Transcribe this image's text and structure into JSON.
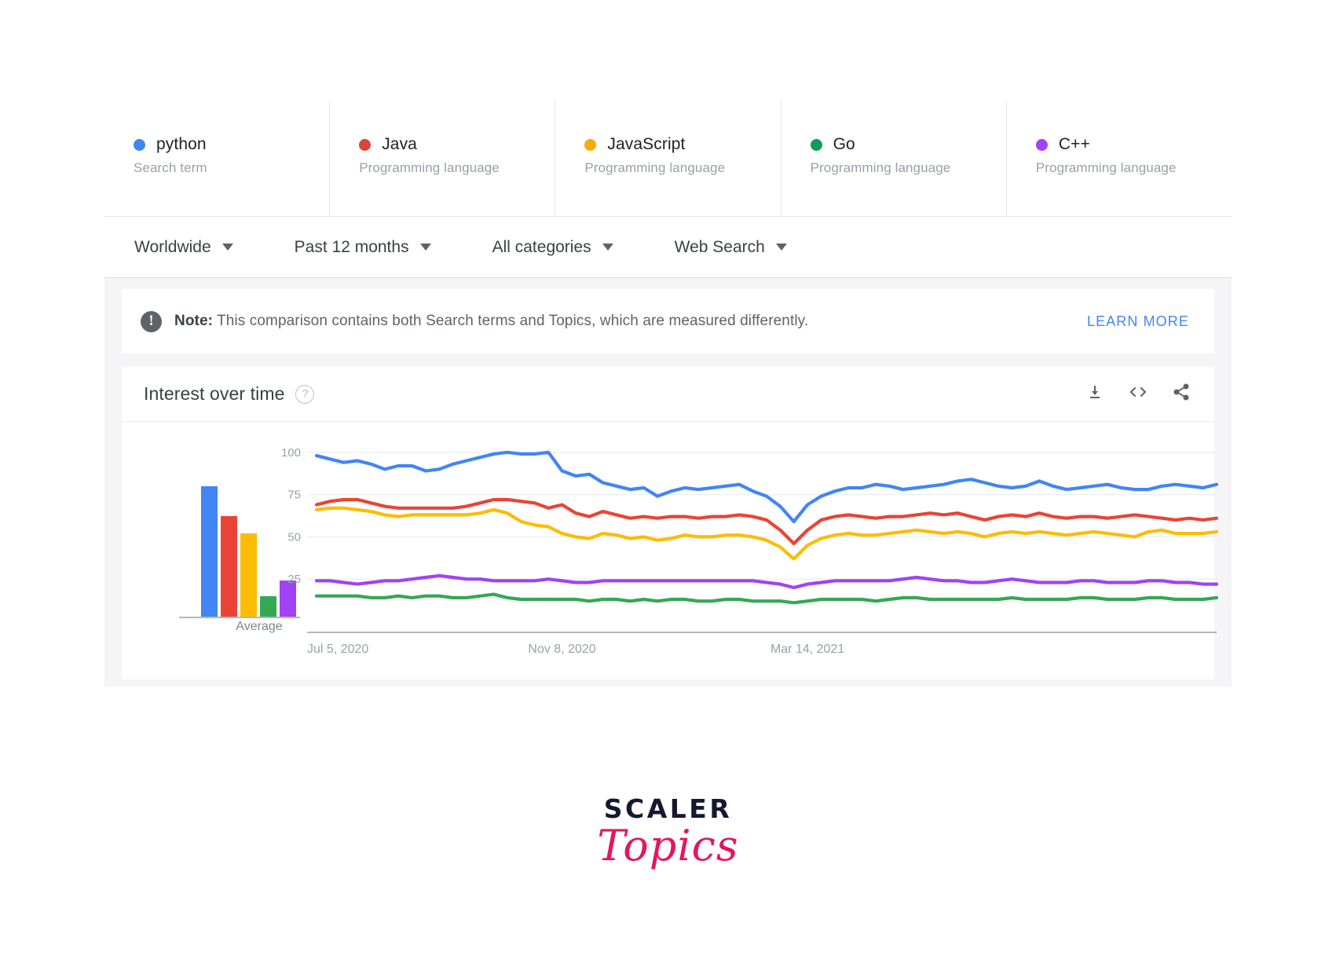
{
  "legend": {
    "items": [
      {
        "term": "python",
        "subtitle": "Search term",
        "color": "#4285f4",
        "dot": "legend-color-dot"
      },
      {
        "term": "Java",
        "subtitle": "Programming language",
        "color": "#db4437",
        "dot": "legend-color-dot"
      },
      {
        "term": "JavaScript",
        "subtitle": "Programming language",
        "color": "#f9ab00",
        "dot": "legend-color-dot"
      },
      {
        "term": "Go",
        "subtitle": "Programming language",
        "color": "#0f9d58",
        "dot": "legend-color-dot"
      },
      {
        "term": "C++",
        "subtitle": "Programming language",
        "color": "#a142f4",
        "dot": "legend-color-dot"
      }
    ]
  },
  "filters": [
    {
      "label": "Worldwide"
    },
    {
      "label": "Past 12 months"
    },
    {
      "label": "All categories"
    },
    {
      "label": "Web Search"
    }
  ],
  "note": {
    "icon": "exclamation-icon",
    "bold": "Note:",
    "text": " This comparison contains both Search terms and Topics, which are measured differently.",
    "learn_more": "LEARN MORE",
    "link_color": "#4285f4"
  },
  "chart_header": {
    "title": "Interest over time",
    "help_icon": "question-mark-icon",
    "actions": [
      {
        "name": "download-icon"
      },
      {
        "name": "embed-code-icon"
      },
      {
        "name": "share-icon"
      }
    ]
  },
  "chart_data": [
    {
      "type": "bar",
      "title": "Average",
      "categories": [
        "python",
        "Java",
        "JavaScript",
        "Go",
        "C++"
      ],
      "values": [
        83,
        64,
        53,
        13,
        23
      ],
      "colors": [
        "#4285f4",
        "#ea4335",
        "#fbbc04",
        "#34a853",
        "#a142f4"
      ],
      "ylim": [
        0,
        100
      ],
      "xlabel": "Average",
      "ylabel": "",
      "grid": false
    },
    {
      "type": "line",
      "title": "Interest over time",
      "xlabel": "",
      "ylabel": "",
      "ylim": [
        0,
        105
      ],
      "yticks": [
        25,
        50,
        75,
        100
      ],
      "grid": true,
      "legend_position": "top",
      "xtick_labels": [
        "Jul 5, 2020",
        "Nov 8, 2020",
        "Mar 14, 2021"
      ],
      "xtick_positions": [
        0,
        18,
        36
      ],
      "series": [
        {
          "name": "python",
          "color": "#4285f4",
          "values": [
            98,
            96,
            94,
            95,
            93,
            90,
            92,
            92,
            89,
            90,
            93,
            95,
            97,
            99,
            100,
            99,
            99,
            100,
            89,
            86,
            87,
            82,
            80,
            78,
            79,
            74,
            77,
            79,
            78,
            79,
            80,
            81,
            77,
            74,
            68,
            59,
            69,
            74,
            77,
            79,
            79,
            81,
            80,
            78,
            79,
            80,
            81,
            83,
            84,
            82,
            80,
            79,
            80,
            83,
            80,
            78,
            79,
            80,
            81,
            79,
            78,
            78,
            80,
            81,
            80,
            79,
            81
          ]
        },
        {
          "name": "Java",
          "color": "#ea4335",
          "values": [
            69,
            71,
            72,
            72,
            70,
            68,
            67,
            67,
            67,
            67,
            67,
            68,
            70,
            72,
            72,
            71,
            70,
            67,
            69,
            64,
            62,
            65,
            63,
            61,
            62,
            61,
            62,
            62,
            61,
            62,
            62,
            63,
            62,
            60,
            54,
            46,
            54,
            60,
            62,
            63,
            62,
            61,
            62,
            62,
            63,
            64,
            63,
            64,
            62,
            60,
            62,
            63,
            62,
            64,
            62,
            61,
            62,
            62,
            61,
            62,
            63,
            62,
            61,
            60,
            61,
            60,
            61
          ]
        },
        {
          "name": "JavaScript",
          "color": "#fbbc04",
          "values": [
            66,
            67,
            67,
            66,
            65,
            63,
            62,
            63,
            63,
            63,
            63,
            63,
            64,
            66,
            64,
            59,
            57,
            56,
            52,
            50,
            49,
            52,
            51,
            49,
            50,
            48,
            49,
            51,
            50,
            50,
            51,
            51,
            50,
            48,
            44,
            37,
            45,
            49,
            51,
            52,
            51,
            51,
            52,
            53,
            54,
            53,
            52,
            53,
            52,
            50,
            52,
            53,
            52,
            53,
            52,
            51,
            52,
            53,
            52,
            51,
            50,
            53,
            54,
            52,
            52,
            52,
            53
          ]
        },
        {
          "name": "Go",
          "color": "#34a853",
          "values": [
            15,
            15,
            15,
            15,
            14,
            14,
            15,
            14,
            15,
            15,
            14,
            14,
            15,
            16,
            14,
            13,
            13,
            13,
            13,
            13,
            12,
            13,
            13,
            12,
            13,
            12,
            13,
            13,
            12,
            12,
            13,
            13,
            12,
            12,
            12,
            11,
            12,
            13,
            13,
            13,
            13,
            12,
            13,
            14,
            14,
            13,
            13,
            13,
            13,
            13,
            13,
            14,
            13,
            13,
            13,
            13,
            14,
            14,
            13,
            13,
            13,
            14,
            14,
            13,
            13,
            13,
            14
          ]
        },
        {
          "name": "C++",
          "color": "#a142f4",
          "values": [
            24,
            24,
            23,
            22,
            23,
            24,
            24,
            25,
            26,
            27,
            26,
            25,
            25,
            24,
            24,
            24,
            24,
            25,
            24,
            23,
            23,
            24,
            24,
            24,
            24,
            24,
            24,
            24,
            24,
            24,
            24,
            24,
            24,
            23,
            22,
            20,
            22,
            23,
            24,
            24,
            24,
            24,
            24,
            25,
            26,
            25,
            24,
            24,
            23,
            23,
            24,
            25,
            24,
            23,
            23,
            23,
            24,
            24,
            23,
            23,
            23,
            24,
            24,
            23,
            23,
            22,
            22
          ]
        }
      ]
    }
  ],
  "logo": {
    "line1": "SCALER",
    "line2": "Topics",
    "color1": "#16182f",
    "color2": "#e3175c"
  }
}
